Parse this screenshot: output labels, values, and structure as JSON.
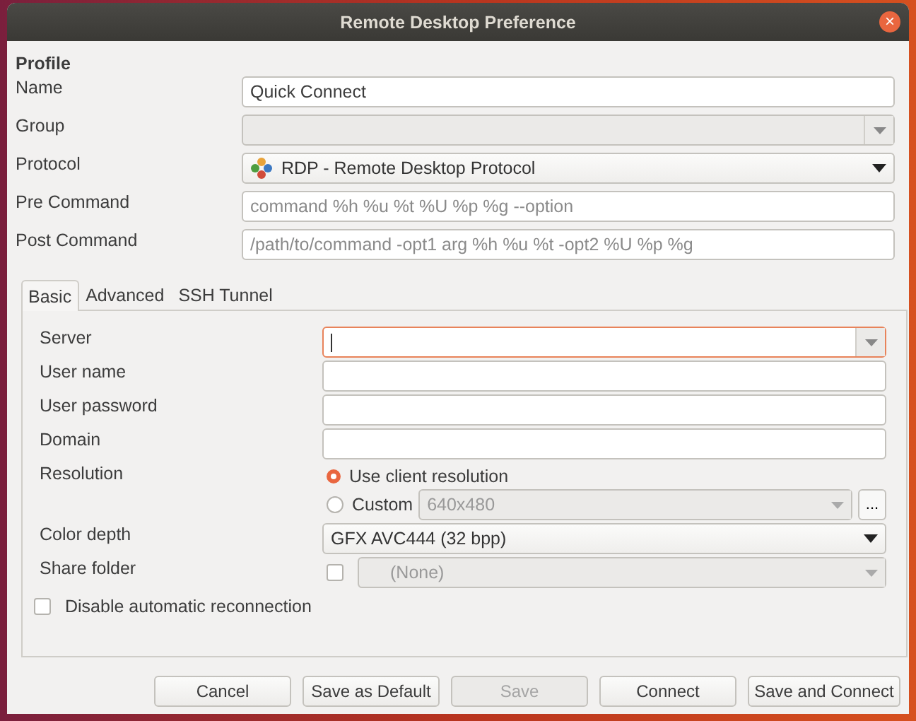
{
  "window": {
    "title": "Remote Desktop Preference",
    "close": "×"
  },
  "profile": {
    "heading": "Profile",
    "rows": [
      {
        "label": "Name",
        "kind": "text",
        "value": "Quick Connect"
      },
      {
        "label": "Group",
        "kind": "combo",
        "value": "",
        "disabled": true
      },
      {
        "label": "Protocol",
        "kind": "select",
        "value": "RDP - Remote Desktop Protocol",
        "icon": true
      },
      {
        "label": "Pre Command",
        "kind": "text",
        "placeholder": "command %h %u %t %U %p %g --option"
      },
      {
        "label": "Post Command",
        "kind": "text",
        "placeholder": "/path/to/command -opt1 arg %h %u %t -opt2 %U %p %g"
      }
    ]
  },
  "tabs": [
    {
      "label": "Basic",
      "selected": true
    },
    {
      "label": "Advanced",
      "selected": false
    },
    {
      "label": "SSH Tunnel",
      "selected": false
    }
  ],
  "basic": {
    "rows": [
      {
        "label": "Server",
        "kind": "combo",
        "value": "",
        "focused": true
      },
      {
        "label": "User name",
        "kind": "text",
        "value": ""
      },
      {
        "label": "User password",
        "kind": "text",
        "value": ""
      },
      {
        "label": "Domain",
        "kind": "text",
        "value": ""
      },
      {
        "label": "Resolution",
        "kind": "radios",
        "options": [
          {
            "label": "Use client resolution",
            "selected": true
          },
          {
            "label": "Custom",
            "selected": false,
            "combo": "640x480",
            "button": "..."
          }
        ]
      },
      {
        "label": "Color depth",
        "kind": "select",
        "value": "GFX AVC444 (32 bpp)"
      },
      {
        "label": "Share folder",
        "kind": "checkcombo",
        "checked": false,
        "value": "(None)"
      }
    ],
    "reconnect": {
      "label": "Disable automatic reconnection",
      "checked": false
    }
  },
  "buttons": [
    {
      "label": "Cancel",
      "disabled": false
    },
    {
      "label": "Save as Default",
      "disabled": false
    },
    {
      "label": "Save",
      "disabled": true
    },
    {
      "label": "Connect",
      "disabled": false
    },
    {
      "label": "Save and Connect",
      "disabled": false
    }
  ]
}
